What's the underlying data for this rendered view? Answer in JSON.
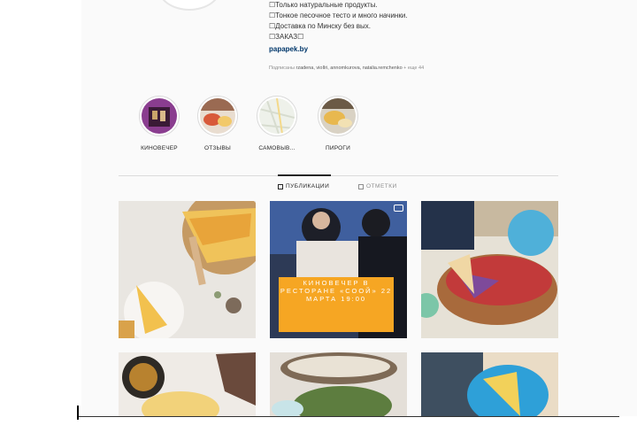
{
  "profile": {
    "bio_lines": [
      "☐Только натуральные продукты.",
      "☐Тонкое песочное тесто и много начинки.",
      "☐Доставка по Минску без вых.",
      "☐ЗАКАЗ☐"
    ],
    "website": "papapek.by",
    "followed_by_prefix": "Подписаны",
    "followed_by_names": "rzadena, vioIlri, annomkurova, natalia.remchenko",
    "followed_by_suffix": "+ еще 44"
  },
  "highlights": [
    {
      "label": "КИНОВЕЧЕР",
      "icon": "movie-night-icon"
    },
    {
      "label": "ОТЗЫВЫ",
      "icon": "reviews-icon"
    },
    {
      "label": "САМОВЫВ...",
      "icon": "pickup-map-icon"
    },
    {
      "label": "ПИРОГИ",
      "icon": "pies-icon"
    }
  ],
  "tabs": {
    "posts": "ПУБЛИКАЦИИ",
    "tagged": "ОТМЕТКИ"
  },
  "posts": {
    "promo_text": "КИНОВЕЧЕР В РЕСТОРАНЕ «СООЙ» 22 МАРТА 19:00"
  },
  "colors": {
    "link": "#00376b",
    "promo": "#f6a623",
    "divider": "#dbdbdb",
    "muted": "#8e8e8e"
  }
}
